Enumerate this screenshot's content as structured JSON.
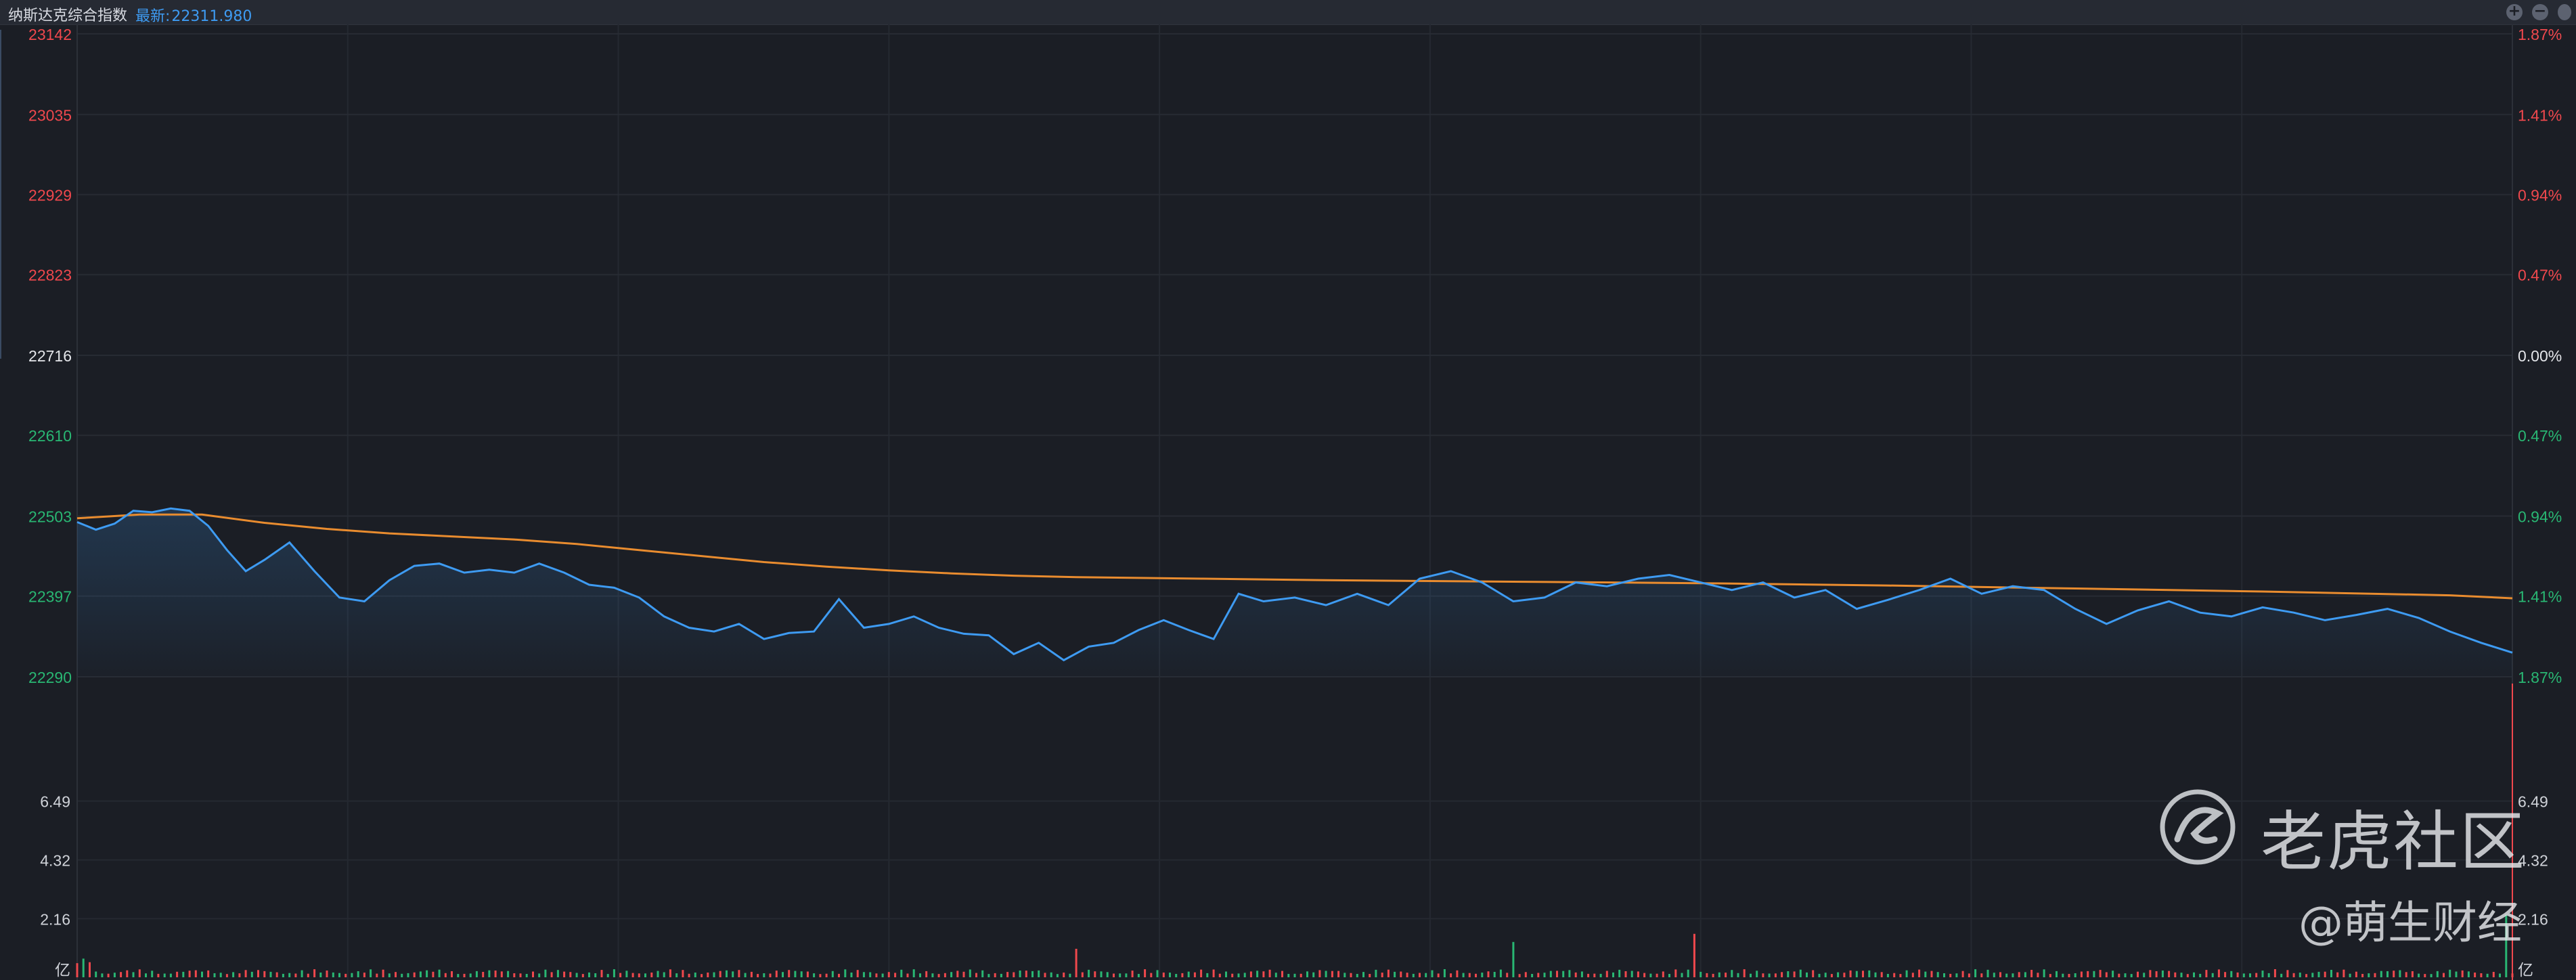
{
  "header": {
    "title": "纳斯达克综合指数",
    "latest_label": "最新:",
    "latest_value": "22311.980",
    "zoom_in_icon": "plus-circle-icon",
    "zoom_out_icon": "minus-circle-icon"
  },
  "colors": {
    "background": "#1b1e25",
    "up": "#f0484d",
    "down": "#29b773",
    "neutral": "#e4e6ea",
    "price_line": "#3e9bf2",
    "avg_line": "#e98c2f"
  },
  "watermark": {
    "brand": "老虎社区",
    "handle": "@萌生财经",
    "logo_icon": "tiger-logo-icon"
  },
  "chart_data": {
    "type": "line",
    "title": "纳斯达克综合指数",
    "price_axis": {
      "ylim": [
        22290,
        23142
      ],
      "left_ticks": [
        "23142",
        "23035",
        "22929",
        "22823",
        "22716",
        "22610",
        "22503",
        "22397",
        "22290"
      ],
      "tick_values": [
        23142,
        23035,
        22929,
        22823,
        22716,
        22610,
        22503,
        22397,
        22290
      ],
      "right_ticks": [
        "1.87%",
        "1.41%",
        "0.94%",
        "0.47%",
        "0.00%",
        "0.47%",
        "0.94%",
        "1.41%",
        "1.87%"
      ],
      "reference": 22716
    },
    "volume_axis": {
      "ticks": [
        "6.49",
        "4.32",
        "2.16"
      ],
      "tick_values": [
        6.49,
        4.32,
        2.16
      ],
      "unit": "亿",
      "ymax": 8.2
    },
    "series": [
      {
        "name": "price",
        "x": [
          0,
          3,
          6,
          9,
          12,
          15,
          18,
          21,
          24,
          27,
          30,
          34,
          38,
          42,
          46,
          50,
          54,
          58,
          62,
          66,
          70,
          74,
          78,
          82,
          86,
          90,
          94,
          98,
          102,
          106,
          110,
          114,
          118,
          122,
          126,
          130,
          134,
          138,
          142,
          146,
          150,
          154,
          158,
          162,
          166,
          170,
          174,
          178,
          182,
          186,
          190,
          195,
          200,
          205,
          210,
          215,
          220,
          225,
          230,
          235,
          240,
          245,
          250,
          255,
          260,
          265,
          270,
          275,
          280,
          285,
          290,
          295,
          300,
          305,
          310,
          315,
          320,
          325,
          330,
          335,
          340,
          345,
          350,
          355,
          360,
          365,
          370,
          375,
          380,
          385,
          390
        ],
        "values": [
          22495,
          22485,
          22493,
          22510,
          22508,
          22513,
          22510,
          22490,
          22458,
          22430,
          22445,
          22468,
          22430,
          22395,
          22390,
          22418,
          22437,
          22440,
          22428,
          22432,
          22428,
          22440,
          22428,
          22412,
          22408,
          22395,
          22370,
          22355,
          22350,
          22360,
          22340,
          22348,
          22350,
          22393,
          22355,
          22360,
          22370,
          22355,
          22347,
          22345,
          22320,
          22335,
          22312,
          22330,
          22335,
          22352,
          22365,
          22352,
          22340,
          22400,
          22390,
          22395,
          22385,
          22400,
          22385,
          22420,
          22430,
          22415,
          22390,
          22395,
          22415,
          22410,
          22420,
          22425,
          22415,
          22405,
          22415,
          22395,
          22405,
          22380,
          22392,
          22405,
          22420,
          22400,
          22410,
          22405,
          22380,
          22360,
          22378,
          22390,
          22375,
          22370,
          22382,
          22375,
          22365,
          22372,
          22380,
          22368,
          22350,
          22335,
          22322
        ],
        "color": "#3e9bf2"
      },
      {
        "name": "average",
        "x": [
          0,
          10,
          20,
          30,
          40,
          50,
          60,
          70,
          80,
          90,
          100,
          110,
          120,
          130,
          140,
          150,
          160,
          170,
          180,
          200,
          230,
          260,
          290,
          320,
          350,
          380,
          390
        ],
        "values": [
          22500,
          22505,
          22505,
          22494,
          22486,
          22480,
          22476,
          22472,
          22466,
          22458,
          22450,
          22442,
          22436,
          22431,
          22427,
          22424,
          22422,
          22421,
          22420,
          22418,
          22416,
          22414,
          22411,
          22407,
          22403,
          22398,
          22394
        ],
        "color": "#e98c2f"
      },
      {
        "name": "volume",
        "color_up": "#f0484d",
        "color_down": "#29b773",
        "spikes": [
          {
            "x": 259,
            "value": 1.6,
            "dir": "up"
          },
          {
            "x": 230,
            "value": 1.3,
            "dir": "down"
          },
          {
            "x": 160,
            "value": 1.05,
            "dir": "up"
          },
          {
            "x": 389,
            "value": 2.3,
            "dir": "down"
          }
        ]
      }
    ]
  }
}
